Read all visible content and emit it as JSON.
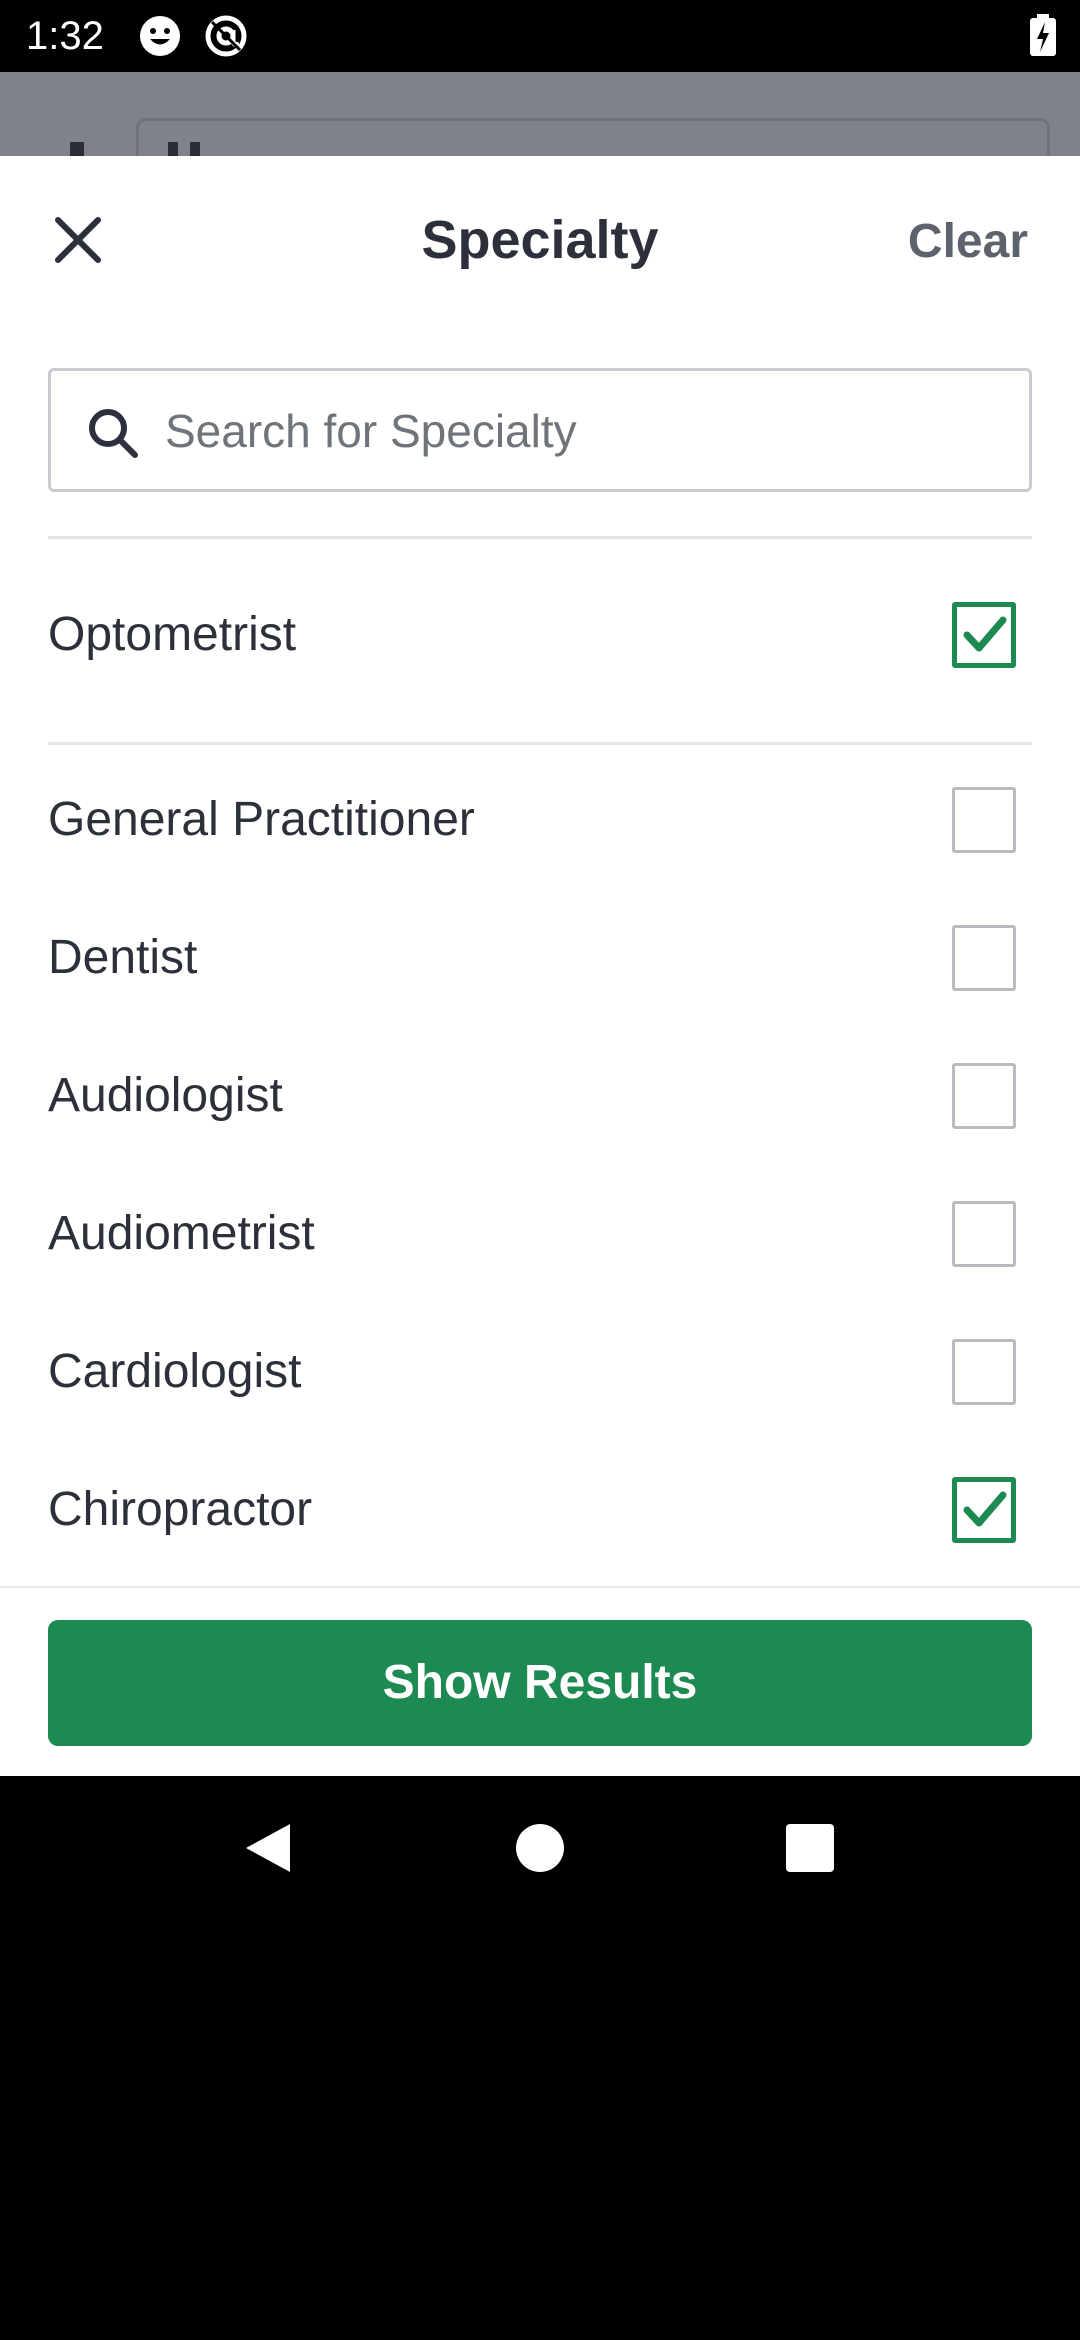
{
  "status_bar": {
    "time": "1:32",
    "icons": [
      "smiley-icon",
      "at-sign-icon",
      "battery-charging-icon"
    ]
  },
  "sheet": {
    "title": "Specialty",
    "clear_label": "Clear",
    "close_icon": "close-icon"
  },
  "search": {
    "placeholder": "Search for Specialty",
    "value": ""
  },
  "selected_options": [
    {
      "label": "Optometrist",
      "checked": true
    }
  ],
  "options": [
    {
      "label": "General Practitioner",
      "checked": false
    },
    {
      "label": "Dentist",
      "checked": false
    },
    {
      "label": "Audiologist",
      "checked": false
    },
    {
      "label": "Audiometrist",
      "checked": false
    },
    {
      "label": "Cardiologist",
      "checked": false
    },
    {
      "label": "Chiropractor",
      "checked": true
    }
  ],
  "footer": {
    "primary_label": "Show Results"
  },
  "colors": {
    "accent": "#1c8a51",
    "text": "#2b303b",
    "muted": "#5d636c"
  },
  "nav_bar": {
    "icons": [
      "back-icon",
      "home-icon",
      "recents-icon"
    ]
  }
}
